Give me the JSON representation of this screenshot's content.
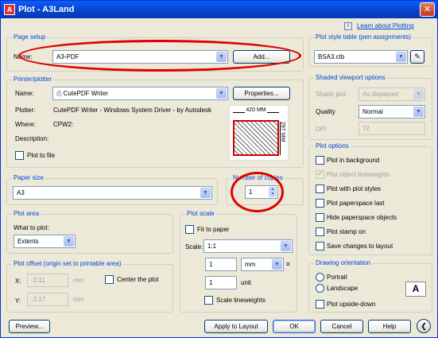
{
  "window": {
    "title": "Plot - A3Land",
    "close": "✕"
  },
  "help_link": "Learn about Plotting",
  "page_setup": {
    "label": "Page setup",
    "name_label": "Name:",
    "name_value": "A3-PDF",
    "add_button": "Add..."
  },
  "printer": {
    "label": "Printer/plotter",
    "name_label": "Name:",
    "name_value": "CutePDF Writer",
    "properties_button": "Properties...",
    "plotter_label": "Plotter:",
    "plotter_value": "CutePDF Writer - Windows System Driver - by Autodesk",
    "where_label": "Where:",
    "where_value": "CPW2:",
    "description_label": "Description:",
    "plot_to_file": "Plot to file",
    "preview_width": "420 MM",
    "preview_height": "297 MM"
  },
  "paper_size": {
    "label": "Paper size",
    "value": "A3"
  },
  "copies": {
    "label": "Number of copies",
    "value": "1"
  },
  "plot_area": {
    "label": "Plot area",
    "what_label": "What to plot:",
    "value": "Extents"
  },
  "plot_offset": {
    "label": "Plot offset (origin set to printable area)",
    "x_label": "X:",
    "x_value": "-3.11",
    "y_label": "Y:",
    "y_value": "-3.17",
    "unit": "mm",
    "center": "Center the plot"
  },
  "plot_scale": {
    "label": "Plot scale",
    "fit": "Fit to paper",
    "scale_label": "Scale:",
    "scale_value": "1:1",
    "val1": "1",
    "unit1": "mm",
    "val2": "1",
    "unit2": "unit",
    "lineweights": "Scale lineweights"
  },
  "plot_style": {
    "label": "Plot style table (pen assignments)",
    "value": "BSA3.ctb"
  },
  "shaded": {
    "label": "Shaded viewport options",
    "shade_label": "Shade plot",
    "shade_value": "As displayed",
    "quality_label": "Quality",
    "quality_value": "Normal",
    "dpi_label": "DPI",
    "dpi_value": "72"
  },
  "plot_options": {
    "label": "Plot options",
    "items": [
      "Plot in background",
      "Plot object lineweights",
      "Plot with plot styles",
      "Plot paperspace last",
      "Hide paperspace objects",
      "Plot stamp on",
      "Save changes to layout"
    ]
  },
  "orientation": {
    "label": "Drawing orientation",
    "portrait": "Portrait",
    "landscape": "Landscape",
    "upside": "Plot upside-down",
    "icon": "A"
  },
  "buttons": {
    "preview": "Preview...",
    "apply": "Apply to Layout",
    "ok": "OK",
    "cancel": "Cancel",
    "help": "Help",
    "expand": "❮"
  }
}
